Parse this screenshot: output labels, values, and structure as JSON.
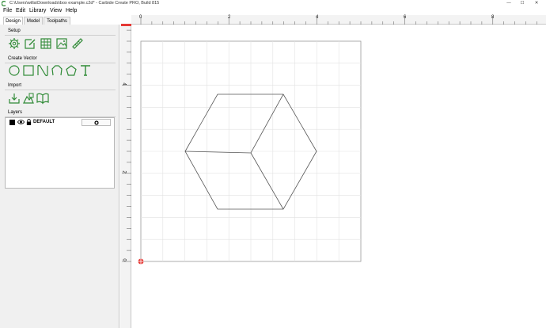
{
  "window": {
    "title": "C:\\Users\\willa\\Downloads\\box example.c2d* - Carbide Create PRO, Build 815",
    "controls": [
      "—",
      "☐",
      "✕"
    ]
  },
  "menu": [
    "File",
    "Edit",
    "Library",
    "View",
    "Help"
  ],
  "tabs": [
    "Design",
    "Model",
    "Toolpaths"
  ],
  "panel": {
    "setup_label": "Setup",
    "setup_tools": [
      "gear-icon",
      "edit-icon",
      "grid-icon",
      "image-icon",
      "measure-icon"
    ],
    "create_label": "Create Vector",
    "create_tools": [
      "circle-icon",
      "rectangle-icon",
      "curve-icon",
      "polyline-icon",
      "polygon-icon",
      "text-icon"
    ],
    "import_label": "Import",
    "import_tools": [
      "import-icon",
      "import-bitmap-icon",
      "library-icon"
    ],
    "layers_label": "Layers",
    "layers": [
      {
        "name": "DEFAULT",
        "color": "#000000"
      }
    ]
  },
  "ruler": {
    "h_labels": [
      "0",
      "2",
      "4",
      "6",
      "8"
    ],
    "v_labels": [
      "4",
      "2",
      "0"
    ]
  },
  "colors": {
    "accent": "#2f8a36",
    "origin": "#e53935"
  }
}
